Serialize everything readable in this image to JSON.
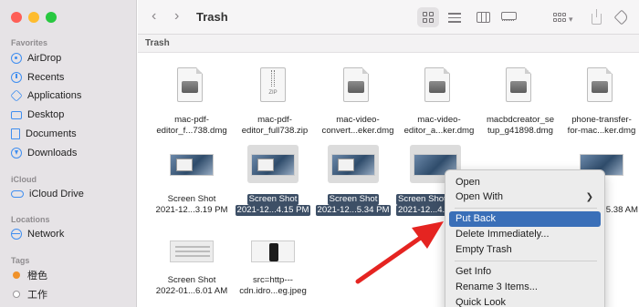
{
  "window": {
    "title": "Trash",
    "path_label": "Trash"
  },
  "sidebar": {
    "favorites_header": "Favorites",
    "favorites": [
      {
        "label": "AirDrop",
        "icon": "airdrop-icon"
      },
      {
        "label": "Recents",
        "icon": "clock-icon"
      },
      {
        "label": "Applications",
        "icon": "applications-icon"
      },
      {
        "label": "Desktop",
        "icon": "desktop-icon"
      },
      {
        "label": "Documents",
        "icon": "document-icon"
      },
      {
        "label": "Downloads",
        "icon": "download-icon"
      }
    ],
    "icloud_header": "iCloud",
    "icloud": [
      {
        "label": "iCloud Drive",
        "icon": "cloud-icon"
      }
    ],
    "locations_header": "Locations",
    "locations": [
      {
        "label": "Network",
        "icon": "network-icon"
      }
    ],
    "tags_header": "Tags",
    "tags": [
      {
        "label": "橙色",
        "color": "#f0922b"
      },
      {
        "label": "工作",
        "color": "#c7c7c7"
      }
    ]
  },
  "files": [
    {
      "name_line1": "mac-pdf-",
      "name_line2": "editor_f...738.dmg",
      "type": "dmg",
      "selected": false
    },
    {
      "name_line1": "mac-pdf-",
      "name_line2": "editor_full738.zip",
      "type": "zip",
      "selected": false
    },
    {
      "name_line1": "mac-video-",
      "name_line2": "convert...eker.dmg",
      "type": "dmg",
      "selected": false
    },
    {
      "name_line1": "mac-video-",
      "name_line2": "editor_a...ker.dmg",
      "type": "dmg",
      "selected": false
    },
    {
      "name_line1": "macbdcreator_se",
      "name_line2": "tup_g41898.dmg",
      "type": "dmg",
      "selected": false
    },
    {
      "name_line1": "phone-transfer-",
      "name_line2": "for-mac...ker.dmg",
      "type": "dmg",
      "selected": false
    },
    {
      "name_line1": "Screen Shot",
      "name_line2": "2021-12...3.19 PM",
      "type": "screenshot",
      "selected": false
    },
    {
      "name_line1": "Screen Shot",
      "name_line2": "2021-12...4.15 PM",
      "type": "screenshot",
      "selected": true
    },
    {
      "name_line1": "Screen Shot",
      "name_line2": "2021-12...5.34 PM",
      "type": "screenshot",
      "selected": true
    },
    {
      "name_line1": "Screen Shot",
      "name_line2": "2021-12...4.3",
      "type": "screenshot",
      "selected": true
    },
    {
      "name_line1": "",
      "name_line2": "5.38 AM",
      "type": "screenshot",
      "selected": false
    },
    {
      "name_line1": "Screen Shot",
      "name_line2": "2022-01...6.01 AM",
      "type": "screenshot-light",
      "selected": false
    },
    {
      "name_line1": "src=http---",
      "name_line2": "cdn.idro...eg.jpeg",
      "type": "phone",
      "selected": false
    }
  ],
  "context_menu": {
    "items": [
      {
        "label": "Open"
      },
      {
        "label": "Open With",
        "submenu": true
      },
      {
        "label": "Put Back",
        "highlighted": true
      },
      {
        "label": "Delete Immediately..."
      },
      {
        "label": "Empty Trash"
      },
      {
        "label": "Get Info"
      },
      {
        "label": "Rename 3 Items..."
      },
      {
        "label": "Quick Look"
      }
    ],
    "highlight_color": "#3a6fb8"
  },
  "colors": {
    "close": "#fe5f57",
    "minimize": "#febc2e",
    "zoom": "#28c840",
    "accent": "#3f8ef0",
    "arrow": "#e52421"
  }
}
